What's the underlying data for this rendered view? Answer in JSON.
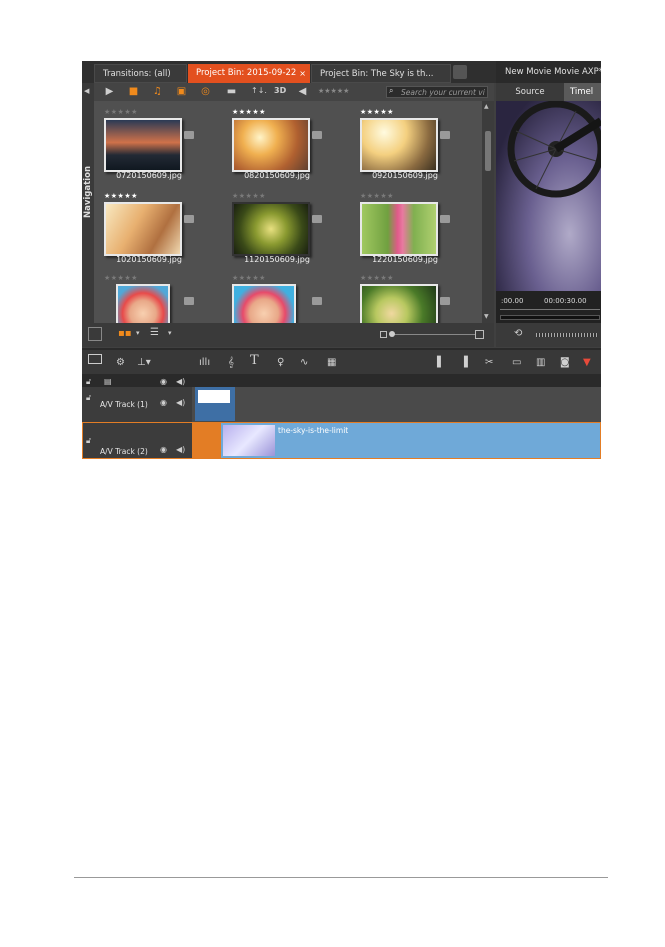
{
  "library": {
    "tabs": [
      {
        "label": "Transitions: (all)"
      },
      {
        "label": "Project Bin: 2015-09-22",
        "close": "×"
      },
      {
        "label": "Project Bin: The Sky is th..."
      }
    ],
    "toolbar": {
      "sort_label": "↑↓.",
      "stereo_label": "3D",
      "rating_filter": "★★★★★",
      "search_placeholder": "Search your current vi"
    },
    "navigation_label": "Navigation",
    "items": [
      {
        "name": "0720150609.jpg",
        "stars": "★★★★★",
        "rated": false
      },
      {
        "name": "0820150609.jpg",
        "stars": "★★★★★",
        "rated": true
      },
      {
        "name": "0920150609.jpg",
        "stars": "★★★★★",
        "rated": true
      },
      {
        "name": "1020150609.jpg",
        "stars": "★★★★★",
        "rated": true
      },
      {
        "name": "1120150609.jpg",
        "stars": "★★★★★",
        "rated": false
      },
      {
        "name": "1220150609.jpg",
        "stars": "★★★★★",
        "rated": false
      },
      {
        "name": "",
        "stars": "★★★★★",
        "rated": false
      },
      {
        "name": "",
        "stars": "★★★★★",
        "rated": false
      },
      {
        "name": "",
        "stars": "★★★★★",
        "rated": false
      }
    ]
  },
  "preview": {
    "title": "New Movie Movie AXP*",
    "tab_source": "Source",
    "tab_timeline": "Timel",
    "timecode_start": ":00.00",
    "timecode_mid": "00:00:30.00"
  },
  "timeline": {
    "tracks": [
      {
        "name": "A/V Track (1)"
      },
      {
        "name": "A/V Track (2)"
      }
    ],
    "clip_label": "the-sky-is-the-limit"
  },
  "colors": {
    "accent_orange": "#e3501f",
    "track_selected": "#e37d25",
    "clip_blue": "#6fa9d8"
  }
}
